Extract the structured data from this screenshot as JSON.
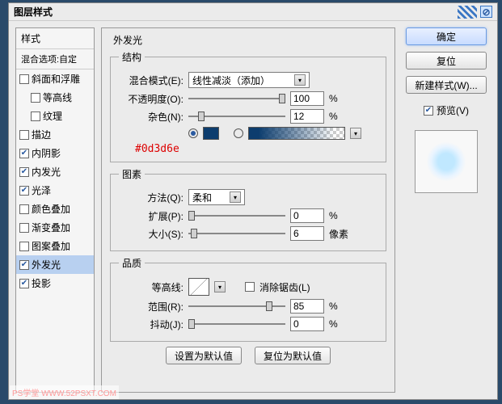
{
  "dialog": {
    "title": "图层样式"
  },
  "styles": {
    "header": "样式",
    "sub": "混合选项:自定",
    "items": [
      {
        "label": "斜面和浮雕",
        "checked": false,
        "indent": 0
      },
      {
        "label": "等高线",
        "checked": false,
        "indent": 1
      },
      {
        "label": "纹理",
        "checked": false,
        "indent": 1
      },
      {
        "label": "描边",
        "checked": false,
        "indent": 0
      },
      {
        "label": "内阴影",
        "checked": true,
        "indent": 0
      },
      {
        "label": "内发光",
        "checked": true,
        "indent": 0
      },
      {
        "label": "光泽",
        "checked": true,
        "indent": 0
      },
      {
        "label": "颜色叠加",
        "checked": false,
        "indent": 0
      },
      {
        "label": "渐变叠加",
        "checked": false,
        "indent": 0
      },
      {
        "label": "图案叠加",
        "checked": false,
        "indent": 0
      },
      {
        "label": "外发光",
        "checked": true,
        "indent": 0,
        "selected": true
      },
      {
        "label": "投影",
        "checked": true,
        "indent": 0
      }
    ]
  },
  "main": {
    "title": "外发光",
    "structure": {
      "legend": "结构",
      "blend_label": "混合模式(E):",
      "blend_value": "线性减淡（添加）",
      "opacity_label": "不透明度(O):",
      "opacity_value": "100",
      "opacity_unit": "%",
      "noise_label": "杂色(N):",
      "noise_value": "12",
      "noise_unit": "%",
      "color_hex": "#0d3d6e"
    },
    "elements": {
      "legend": "图素",
      "technique_label": "方法(Q):",
      "technique_value": "柔和",
      "spread_label": "扩展(P):",
      "spread_value": "0",
      "spread_unit": "%",
      "size_label": "大小(S):",
      "size_value": "6",
      "size_unit": "像素"
    },
    "quality": {
      "legend": "品质",
      "contour_label": "等高线:",
      "antialiased_label": "消除锯齿(L)",
      "antialiased_checked": false,
      "range_label": "范围(R):",
      "range_value": "85",
      "range_unit": "%",
      "jitter_label": "抖动(J):",
      "jitter_value": "0",
      "jitter_unit": "%"
    },
    "footer": {
      "make_default": "设置为默认值",
      "reset_default": "复位为默认值"
    }
  },
  "buttons": {
    "ok": "确定",
    "cancel": "复位",
    "new_style": "新建样式(W)...",
    "preview_label": "预览(V)"
  },
  "watermark": "PS学堂  WWW.52PSXT.COM"
}
